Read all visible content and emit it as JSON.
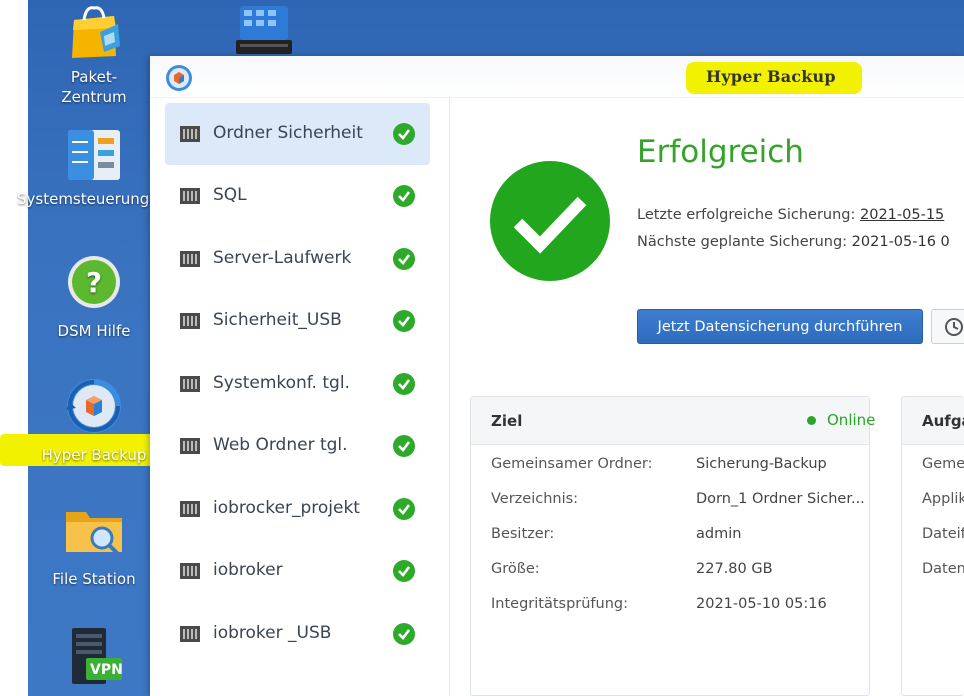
{
  "desktop": {
    "icons": [
      {
        "label_line1": "Paket-",
        "label_line2": "Zentrum"
      },
      {
        "label": "Systemsteuerung"
      },
      {
        "label": "DSM Hilfe"
      },
      {
        "label": "Hyper Backup"
      },
      {
        "label": "File Station"
      },
      {
        "badge": "VPN"
      }
    ]
  },
  "window": {
    "title": "Hyper Backup"
  },
  "sidebar": {
    "tasks": [
      {
        "label": "Ordner Sicherheit"
      },
      {
        "label": "SQL"
      },
      {
        "label": "Server-Laufwerk"
      },
      {
        "label": "Sicherheit_USB"
      },
      {
        "label": "Systemkonf. tgl."
      },
      {
        "label": "Web Ordner tgl."
      },
      {
        "label": "iobrocker_projekt"
      },
      {
        "label": "iobroker"
      },
      {
        "label": "iobroker _USB"
      }
    ]
  },
  "status": {
    "title": "Erfolgreich",
    "last_label": "Letzte erfolgreiche Sicherung:",
    "last_value": "2021-05-15",
    "next_label": "Nächste geplante Sicherung:",
    "next_value": "2021-05-16 0"
  },
  "actions": {
    "backup_now": "Jetzt Datensicherung durchführen"
  },
  "target_panel": {
    "title": "Ziel",
    "status": "Online",
    "rows": [
      {
        "label": "Gemeinsamer Ordner:",
        "value": "Sicherung-Backup"
      },
      {
        "label": "Verzeichnis:",
        "value": "Dorn_1 Ordner Sicher..."
      },
      {
        "label": "Besitzer:",
        "value": "admin"
      },
      {
        "label": "Größe:",
        "value": "227.80 GB"
      },
      {
        "label": "Integritätsprüfung:",
        "value": "2021-05-10 05:16"
      }
    ]
  },
  "task_panel": {
    "title": "Aufga",
    "rows": [
      {
        "label": "Geme"
      },
      {
        "label": "Applik"
      },
      {
        "label": "Dateif"
      },
      {
        "label": "Daten"
      }
    ]
  },
  "colors": {
    "desktop": "#3a74c1",
    "success": "#35a32a",
    "highlight": "#f2f200",
    "primary_button": "#2d6bbd"
  }
}
